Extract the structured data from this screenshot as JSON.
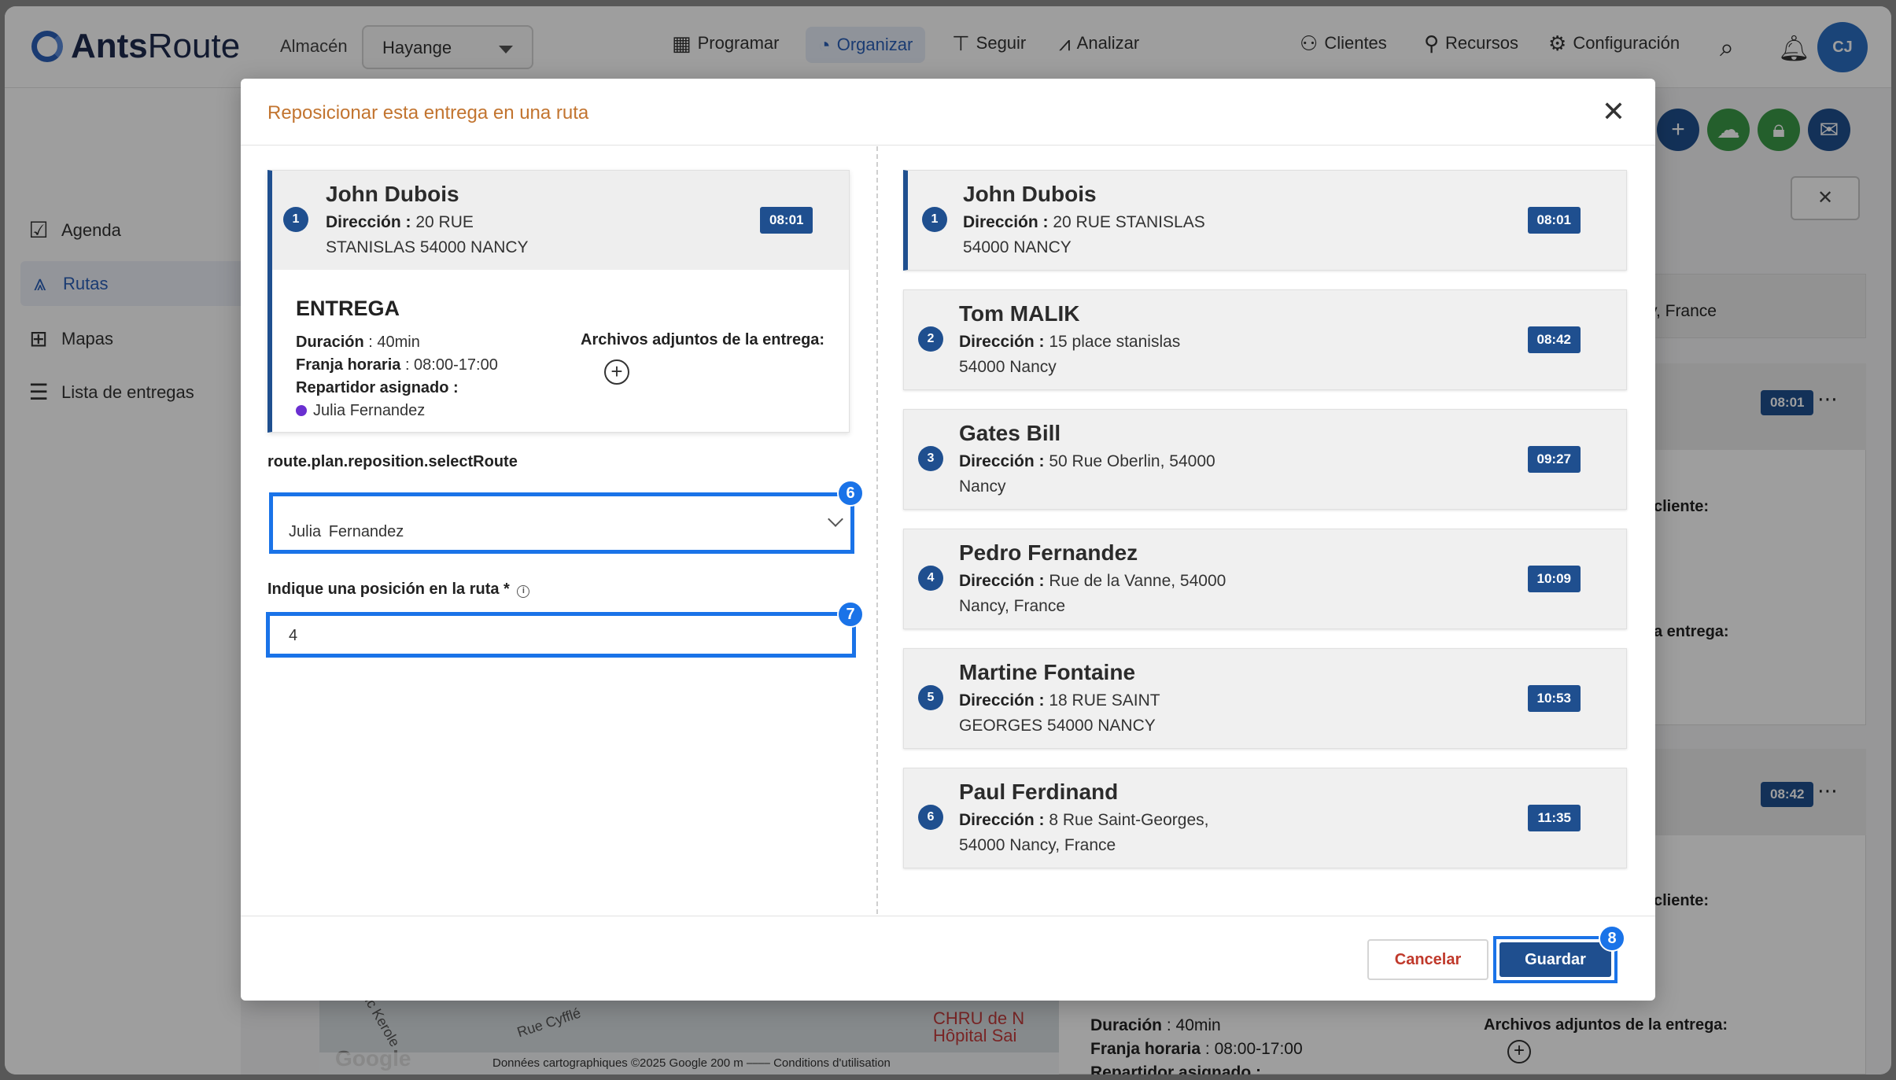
{
  "app": {
    "logo_bold": "Ants",
    "logo_light": "Route",
    "almacen_label": "Almacén",
    "almacen_value": "Hayange",
    "nav": [
      {
        "label": "Programar",
        "icon": "calendar-icon"
      },
      {
        "label": "Organizar",
        "icon": "dashboard-icon",
        "active": true
      },
      {
        "label": "Seguir",
        "icon": "signpost-icon"
      },
      {
        "label": "Analizar",
        "icon": "chart-icon"
      }
    ],
    "right_nav": [
      {
        "label": "Clientes",
        "icon": "users-icon"
      },
      {
        "label": "Recursos",
        "icon": "user-gear-icon"
      },
      {
        "label": "Configuración",
        "icon": "gear-icon"
      }
    ],
    "avatar_initials": "CJ",
    "sidebar": [
      {
        "label": "Agenda",
        "icon": "calendar-check-icon"
      },
      {
        "label": "Rutas",
        "icon": "road-icon",
        "active": true
      },
      {
        "label": "Mapas",
        "icon": "map-icon"
      },
      {
        "label": "Lista de entregas",
        "icon": "list-icon"
      }
    ],
    "bg": {
      "address_tail": "y, France",
      "badge1": "08:01",
      "badge2": "08:42",
      "cliente1": "cliente:",
      "entrega1": "a entrega:",
      "cliente2": "cliente:",
      "duracion_label": "Duración",
      "duracion_value": " : 40min",
      "franja_label": "Franja horaria",
      "franja_value": " : 08:00-17:00",
      "repartidor_label": "Repartidor asignado :",
      "archivos_label": "Archivos adjuntos de la entrega:",
      "map_footer": "Données cartographiques ©2025 Google    200 m ⎯⎯⎯⎯     Conditions d'utilisation",
      "map_google": "Google",
      "map_hosp": "CHRU de N\nHôpital Sai",
      "map_street1": "Rue Cyfflé",
      "map_street2": "uc Kerole"
    }
  },
  "modal": {
    "title": "Reposicionar esta entrega en una ruta",
    "detail": {
      "number": "1",
      "name": "John Dubois",
      "address_label": "Dirección :",
      "address_line1": " 20 RUE",
      "address_line2": "STANISLAS 54000 NANCY",
      "time": "08:01",
      "section_title": "ENTREGA",
      "duracion_label": "Duración",
      "duracion_value": " : 40min",
      "franja_label": "Franja horaria",
      "franja_value": " : 08:00-17:00",
      "repartidor_label": "Repartidor asignado :",
      "repartidor_value": "Julia Fernandez",
      "attachments_label": "Archivos adjuntos de la entrega:"
    },
    "select_route_label": "route.plan.reposition.selectRoute",
    "select_route_value": "Julia Fernandez",
    "position_label": "Indique una posición en la ruta *",
    "position_value": "4",
    "steps": {
      "select": "6",
      "position": "7",
      "save": "8"
    },
    "stops": [
      {
        "number": "1",
        "name": "John Dubois",
        "address_line1": " 20 RUE STANISLAS",
        "address_line2": "54000 NANCY",
        "time": "08:01"
      },
      {
        "number": "2",
        "name": "Tom MALIK",
        "address_line1": " 15 place stanislas",
        "address_line2": "54000 Nancy",
        "time": "08:42"
      },
      {
        "number": "3",
        "name": "Gates Bill",
        "address_line1": " 50 Rue Oberlin, 54000",
        "address_line2": "Nancy",
        "time": "09:27"
      },
      {
        "number": "4",
        "name": "Pedro Fernandez",
        "address_line1": " Rue de la Vanne, 54000",
        "address_line2": "Nancy, France",
        "time": "10:09"
      },
      {
        "number": "5",
        "name": "Martine Fontaine",
        "address_line1": " 18 RUE SAINT",
        "address_line2": "GEORGES 54000 NANCY",
        "time": "10:53"
      },
      {
        "number": "6",
        "name": "Paul Ferdinand",
        "address_line1": " 8 Rue Saint-Georges,",
        "address_line2": "54000 Nancy, France",
        "time": "11:35"
      }
    ],
    "stop_address_label": "Dirección :",
    "cancel_label": "Cancelar",
    "save_label": "Guardar"
  },
  "colors": {
    "accent": "#1f4f8f",
    "highlight": "#1a73e8",
    "title": "#c2742f",
    "cancel": "#c0392b"
  }
}
